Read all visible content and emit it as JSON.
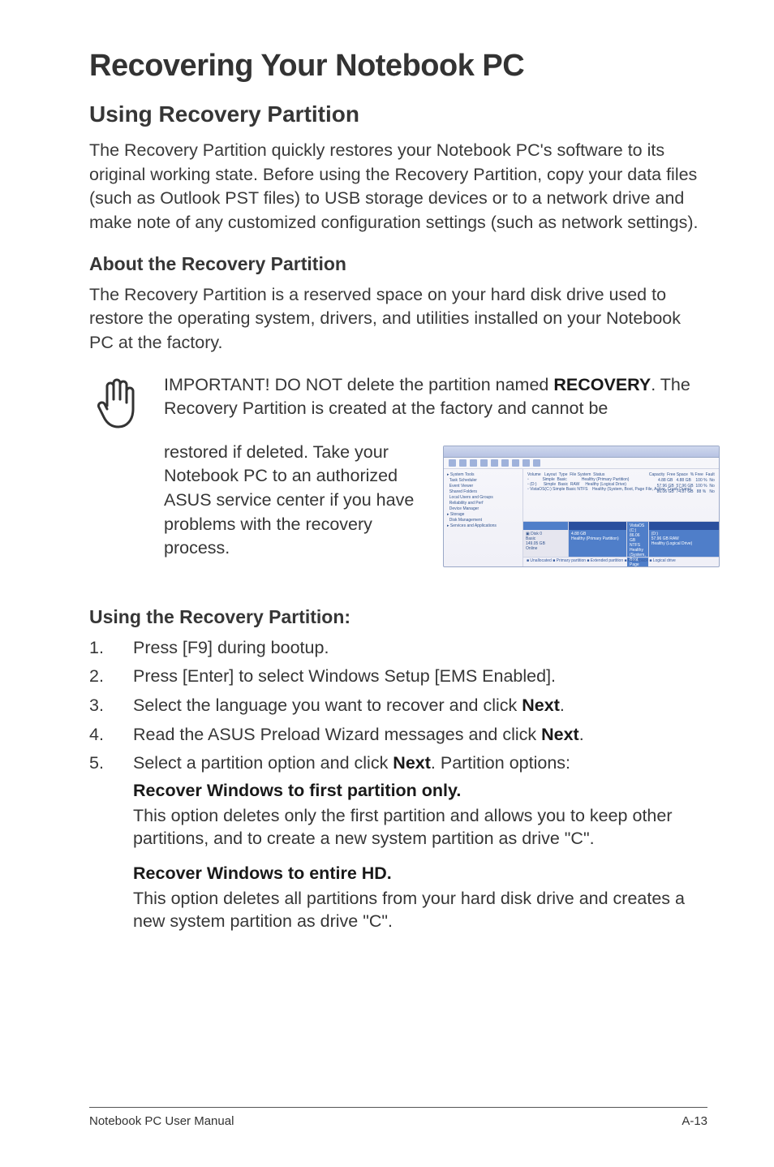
{
  "title": "Recovering Your Notebook PC",
  "section_using_partition": "Using Recovery Partition",
  "intro_paragraph": "The Recovery Partition quickly restores your Notebook PC's software to its original working state. Before using the Recovery Partition, copy your data files (such as Outlook PST files) to USB storage devices or to a network drive and make note of any customized configuration settings (such as network settings).",
  "about_heading": "About the Recovery Partition",
  "about_paragraph": "The Recovery Partition is a reserved space on your hard disk drive used to restore the operating system, drivers, and utilities installed on your Notebook PC at the factory.",
  "important_prefix": "IMPORTANT! DO NOT delete the partition named ",
  "important_bold": "RECOVERY",
  "important_suffix": ". The Recovery Partition is created at the factory and cannot be ",
  "important_continued": "restored if deleted. Take your Notebook PC to an authorized ASUS service center if you have problems with the recovery process.",
  "using_heading": "Using the Recovery Partition:",
  "steps": {
    "s1": "Press [F9] during bootup.",
    "s2": "Press [Enter] to select Windows Setup [EMS Enabled].",
    "s3_pre": "Select the language you want to recover and click ",
    "s3_bold": "Next",
    "s3_post": ".",
    "s4_pre": "Read the ASUS Preload Wizard messages and click ",
    "s4_bold": "Next",
    "s4_post": ".",
    "s5_pre": "Select a partition option and click ",
    "s5_bold": "Next",
    "s5_post": ". Partition options:"
  },
  "opt1_heading": "Recover Windows to first partition only.",
  "opt1_body": "This option deletes only the first partition and allows you to keep other partitions, and to create a new system partition as drive \"C\".",
  "opt2_heading": "Recover Windows to entire HD.",
  "opt2_body": "This option deletes all partitions from your hard disk drive and creates a new system partition as drive \"C\".",
  "footer_left": "Notebook PC User Manual",
  "footer_right": "A-13"
}
